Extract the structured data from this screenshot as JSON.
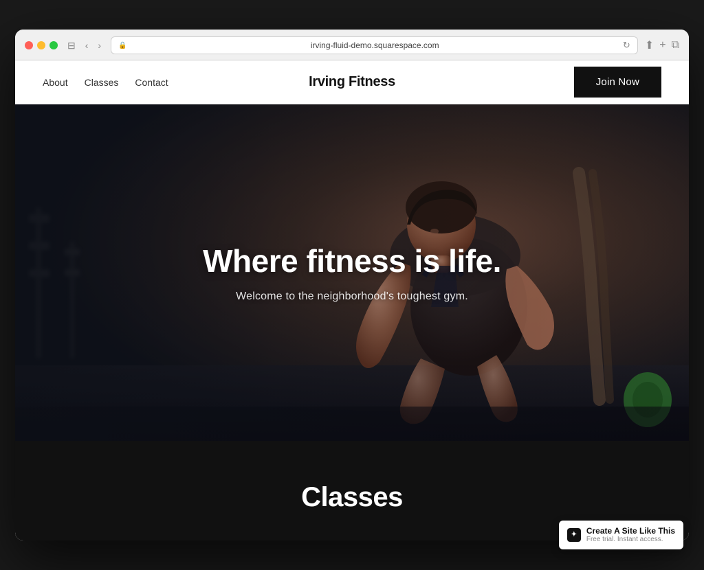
{
  "browser": {
    "url": "irving-fluid-demo.squarespace.com",
    "traffic_lights": [
      "red",
      "yellow",
      "green"
    ]
  },
  "nav": {
    "links": [
      {
        "label": "About",
        "id": "about"
      },
      {
        "label": "Classes",
        "id": "classes"
      },
      {
        "label": "Contact",
        "id": "contact"
      }
    ],
    "brand": "Irving Fitness",
    "cta_label": "Join Now"
  },
  "hero": {
    "title": "Where fitness is life.",
    "subtitle": "Welcome to the neighborhood's toughest gym."
  },
  "classes_section": {
    "title": "Classes"
  },
  "badge": {
    "main": "Create A Site Like This",
    "sub": "Free trial. Instant access."
  }
}
